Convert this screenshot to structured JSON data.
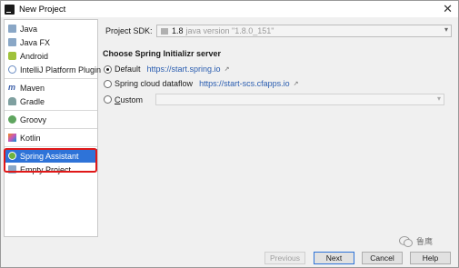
{
  "window": {
    "title": "New Project",
    "close_glyph": "✕"
  },
  "sidebar": {
    "groups": [
      {
        "items": [
          {
            "label": "Java",
            "icon": "folder-icon"
          },
          {
            "label": "Java FX",
            "icon": "folder-icon"
          },
          {
            "label": "Android",
            "icon": "android-icon"
          },
          {
            "label": "IntelliJ Platform Plugin",
            "icon": "plugin-icon"
          }
        ]
      },
      {
        "items": [
          {
            "label": "Maven",
            "icon": "maven-icon"
          },
          {
            "label": "Gradle",
            "icon": "gradle-icon"
          }
        ]
      },
      {
        "items": [
          {
            "label": "Groovy",
            "icon": "groovy-icon"
          }
        ]
      },
      {
        "items": [
          {
            "label": "Kotlin",
            "icon": "kotlin-icon"
          }
        ]
      },
      {
        "items": [
          {
            "label": "Spring Assistant",
            "icon": "spring-icon",
            "selected": true
          },
          {
            "label": "Empty Project",
            "icon": "folder-icon"
          }
        ]
      }
    ],
    "selection_color": "#2e73d8",
    "highlight_color": "#e01818"
  },
  "main": {
    "sdk": {
      "label": "Project SDK:",
      "version": "1.8",
      "description": "java version \"1.8.0_151\""
    },
    "section_title": "Choose Spring Initializr server",
    "options": [
      {
        "label": "Default",
        "url": "https://start.spring.io",
        "checked": true
      },
      {
        "label": "Spring cloud dataflow",
        "url": "https://start-scs.cfapps.io",
        "checked": false
      },
      {
        "label_prefix": "C",
        "label_rest": "ustom",
        "checked": false
      }
    ],
    "ext_glyph": "↗",
    "chevron_glyph": "▾"
  },
  "footer": {
    "previous": "Previous",
    "next": "Next",
    "cancel": "Cancel",
    "help": "Help"
  },
  "watermark": {
    "text": "鲁鹰"
  }
}
